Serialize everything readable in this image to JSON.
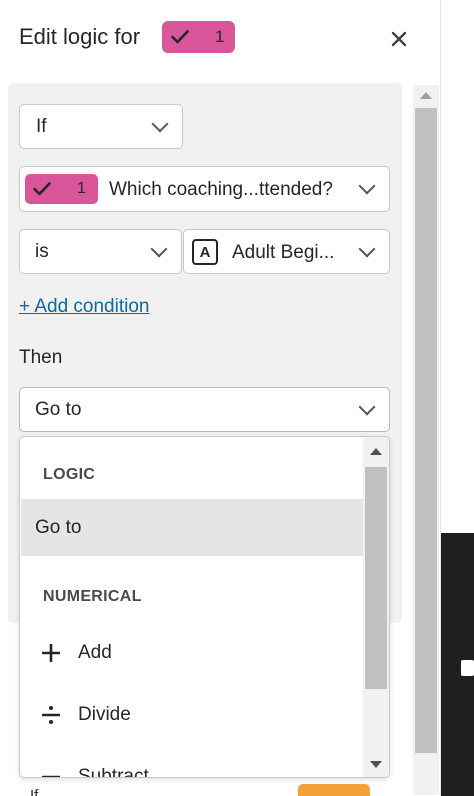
{
  "header": {
    "title": "Edit logic for",
    "question_badge": {
      "number": "1",
      "color": "#d9569b",
      "icon": "check-icon"
    },
    "close_icon": "close-icon"
  },
  "condition": {
    "if_select": "If",
    "question_select": {
      "badge_number": "1",
      "text": "Which coaching...ttended?"
    },
    "operator_select": "is",
    "answer_select": {
      "letter": "A",
      "text": "Adult Begi..."
    },
    "add_condition_link": "+ Add condition"
  },
  "then": {
    "label": "Then",
    "action_select": "Go to"
  },
  "dropdown": {
    "groups": [
      {
        "label": "LOGIC",
        "items": [
          {
            "label": "Go to",
            "icon": "",
            "selected": true
          }
        ]
      },
      {
        "label": "NUMERICAL",
        "items": [
          {
            "label": "Add",
            "icon": "plus-icon"
          },
          {
            "label": "Divide",
            "icon": "divide-icon"
          },
          {
            "label": "Subtract",
            "icon": "minus-icon"
          }
        ]
      }
    ]
  },
  "bottom": {
    "if_peek": "If"
  },
  "colors": {
    "badge": "#d9569b",
    "link": "#0a6b9f",
    "highlight": "#e6e600",
    "panel_bg": "#f1f1f1",
    "orange": "#f5a03a"
  }
}
